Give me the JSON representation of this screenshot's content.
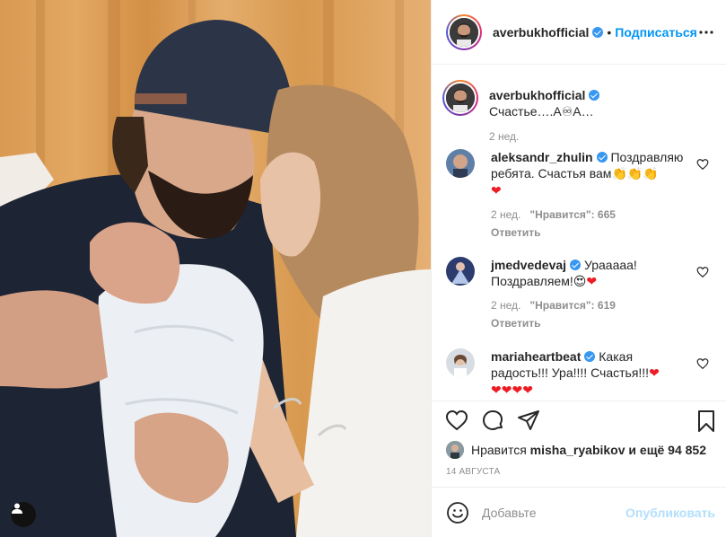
{
  "post": {
    "author": "averbukhofficial",
    "follow_label": "Подписаться",
    "dot": "•"
  },
  "caption": {
    "user": "averbukhofficial",
    "text": "Счастье….А♾А…",
    "time": "2 нед."
  },
  "comments": [
    {
      "user": "aleksandr_zhulin",
      "text": "Поздравляю ребята. Счастья вам",
      "emoji": "👏👏👏",
      "hearts": "❤",
      "time": "2 нед.",
      "likes": "\"Нравится\": 665",
      "reply": "Ответить"
    },
    {
      "user": "jmedvedevaj",
      "text": "Урааааа! Поздравляем!",
      "emoji": "😍",
      "hearts": "❤",
      "time": "2 нед.",
      "likes": "\"Нравится\": 619",
      "reply": "Ответить"
    },
    {
      "user": "mariaheartbeat",
      "text": "Какая радость!!! Ура!!!! Счастья!!!",
      "hearts_inline": "❤",
      "hearts": "❤❤❤❤"
    }
  ],
  "likes": {
    "prefix": "Нравится",
    "user": "misha_ryabikov",
    "suffix": "и ещё 94 852"
  },
  "date": "14 АВГУСТА",
  "composer": {
    "placeholder": "Добавьте",
    "publish": "Опубликовать"
  },
  "icons": {
    "like": "heart-icon",
    "comment": "comment-icon",
    "share": "paper-plane-icon",
    "save": "bookmark-icon",
    "emoji": "smiley-icon",
    "more": "more-dots-icon",
    "tagged_users": "user-icon"
  },
  "colors": {
    "link_blue": "#0095f6",
    "verified_blue": "#3897f0",
    "meta_gray": "#8e8e8e",
    "heart_red": "#ed1c24"
  }
}
